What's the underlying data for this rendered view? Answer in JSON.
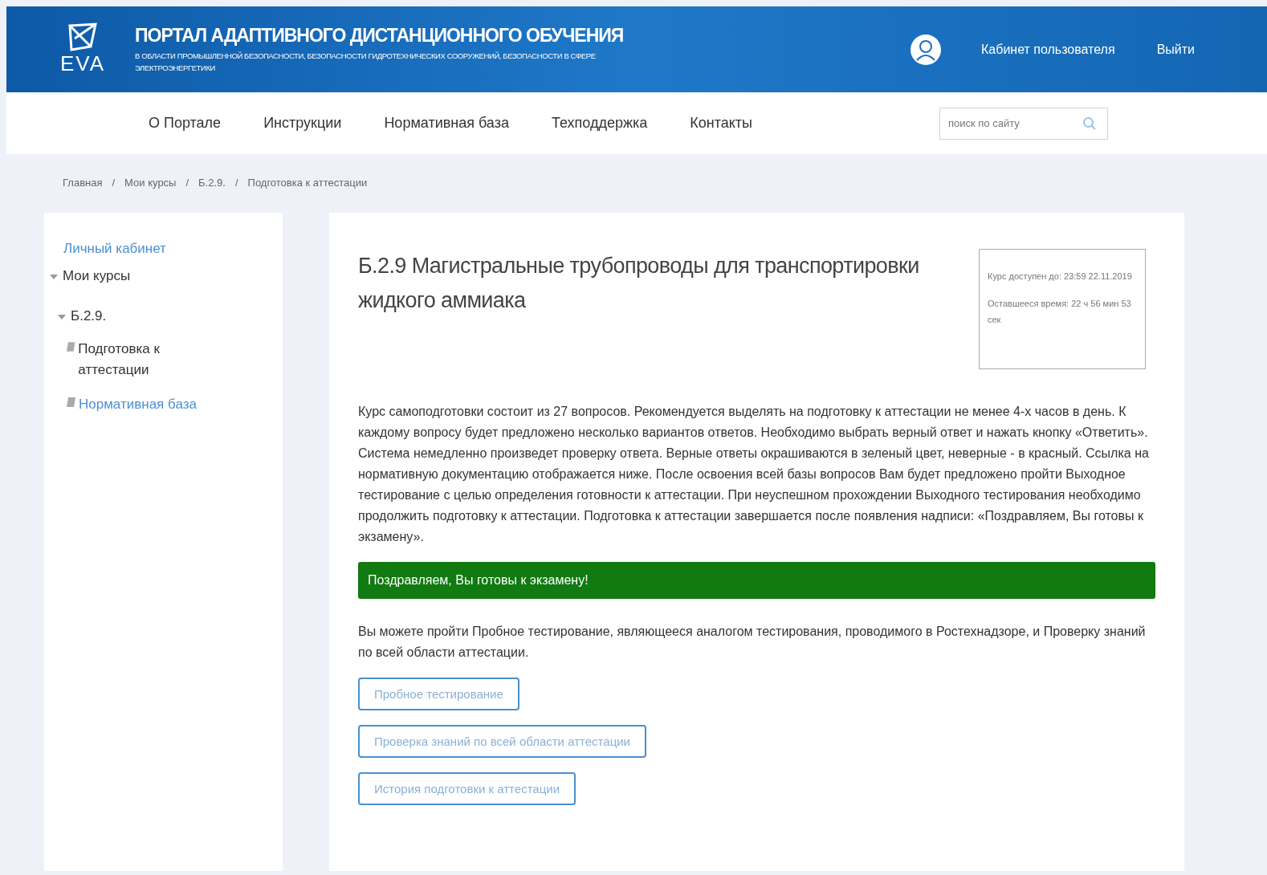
{
  "header": {
    "logo_text": "EVA",
    "title": "ПОРТАЛ АДАПТИВНОГО ДИСТАНЦИОННОГО ОБУЧЕНИЯ",
    "subtitle": "В ОБЛАСТИ ПРОМЫШЛЕННОЙ БЕЗОПАСНОСТИ, БЕЗОПАСНОСТИ ГИДРОТЕХНИЧЕСКИХ СООРУЖЕНИЙ, БЕЗОПАСНОСТИ В СФЕРЕ ЭЛЕКТРОЭНЕРГЕТИКИ",
    "account_link": "Кабинет пользователя",
    "logout_link": "Выйти"
  },
  "nav": {
    "items": [
      "О Портале",
      "Инструкции",
      "Нормативная база",
      "Техподдержка",
      "Контакты"
    ],
    "search": {
      "placeholder": "поиск по сайту"
    }
  },
  "breadcrumbs": [
    "Главная",
    "Мои курсы",
    "Б.2.9.",
    "Подготовка к аттестации"
  ],
  "breadcrumb_separator": "/",
  "sidebar": {
    "top_link": "Личный кабинет",
    "tree": [
      {
        "label": "Мои курсы",
        "kind": "folder",
        "expanded": true,
        "children": [
          {
            "label": "Б.2.9.",
            "kind": "folder",
            "expanded": true,
            "children": [
              {
                "label": "Подготовка к аттестации",
                "kind": "page",
                "selected": true
              },
              {
                "label": "Нормативная база",
                "kind": "page",
                "selected": false
              }
            ]
          }
        ]
      }
    ]
  },
  "course": {
    "title": "Б.2.9 Магистральные трубопроводы для транспортировки жидкого аммиака",
    "info": [
      "Курс доступен до: 23:59 22.11.2019",
      "Оставшееся время: 22 ч 56 мин 53 сек"
    ],
    "description": "Курс самоподготовки состоит из 27 вопросов. Рекомендуется выделять на подготовку к аттестации не менее 4-х часов в день. К каждому вопросу будет предложено несколько вариантов ответов. Необходимо выбрать верный ответ и нажать кнопку «Ответить». Система немедленно произведет проверку ответа. Верные ответы окрашиваются в зеленый цвет, неверные - в красный. Ссылка на нормативную документацию отображается ниже. После освоения всей базы вопросов Вам будет предложено пройти Выходное тестирование с целью определения готовности к аттестации. При неуспешном прохождении Выходного тестирования необходимо продолжить подготовку к аттестации. Подготовка к аттестации завершается после появления надписи: «Поздравляем, Вы готовы к экзамену».",
    "alert": {
      "kind": "success",
      "text": "Поздравляем, Вы готовы к экзамену!"
    },
    "note": "Вы можете пройти Пробное тестирование, являющееся аналогом тестирования, проводимого в Ростехнадзоре, и Проверку знаний по всей области аттестации.",
    "buttons": [
      "Пробное тестирование",
      "Проверка знаний по всей области аттестации",
      "История подготовки к аттестации"
    ]
  }
}
